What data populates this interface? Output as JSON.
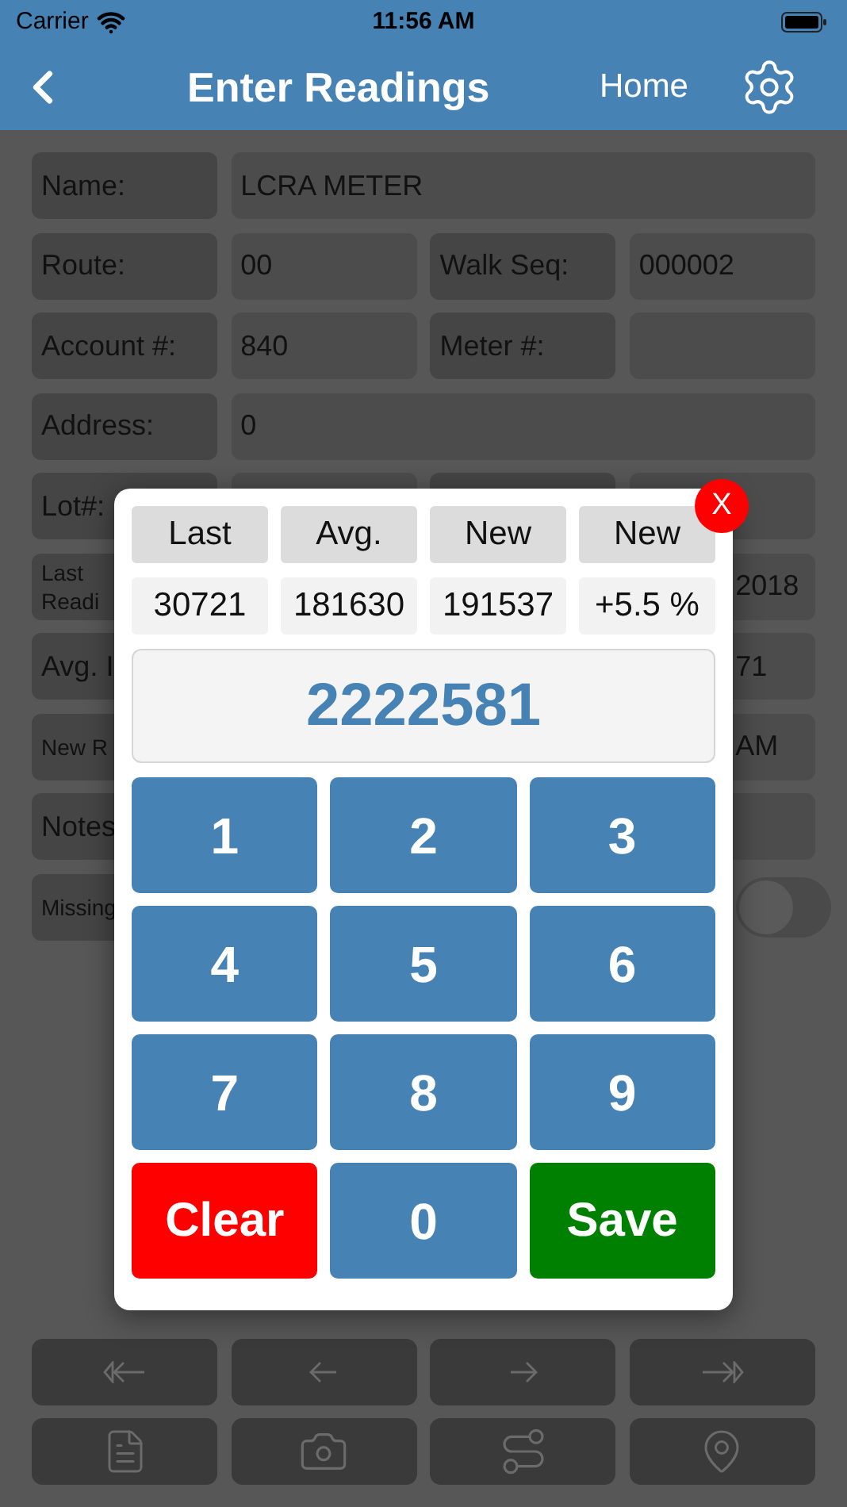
{
  "status_bar": {
    "carrier": "Carrier",
    "time": "11:56 AM"
  },
  "nav": {
    "title": "Enter Readings",
    "home": "Home"
  },
  "form": {
    "rows": [
      {
        "cells": [
          {
            "kind": "label",
            "text": "Name:"
          },
          {
            "kind": "wide",
            "text": "LCRA METER"
          }
        ]
      },
      {
        "cells": [
          {
            "kind": "label",
            "text": "Route:"
          },
          {
            "kind": "value",
            "text": "00"
          },
          {
            "kind": "label",
            "text": "Walk Seq:"
          },
          {
            "kind": "value",
            "text": "000002"
          }
        ]
      },
      {
        "cells": [
          {
            "kind": "label",
            "text": "Account #:"
          },
          {
            "kind": "value",
            "text": "840"
          },
          {
            "kind": "label",
            "text": "Meter #:"
          },
          {
            "kind": "value"
          }
        ]
      },
      {
        "cells": [
          {
            "kind": "label",
            "text": "Address:"
          },
          {
            "kind": "wide",
            "text": "0"
          }
        ]
      },
      {
        "cells": [
          {
            "kind": "label",
            "text": "Lot#:"
          },
          {
            "kind": "value"
          },
          {
            "kind": "label"
          },
          {
            "kind": "value"
          }
        ]
      },
      {
        "cells": [
          {
            "kind": "label",
            "text": "Last Readi",
            "small": true
          },
          {
            "kind": "wide",
            "text": "2018",
            "obscured": true
          }
        ]
      },
      {
        "cells": [
          {
            "kind": "label",
            "text": "Avg. I"
          },
          {
            "kind": "wide",
            "text": "71",
            "obscured": true
          }
        ]
      },
      {
        "cells": [
          {
            "kind": "label",
            "text": "New R",
            "small": true
          },
          {
            "kind": "wide",
            "text": "AM",
            "obscured": true
          }
        ]
      },
      {
        "cells": [
          {
            "kind": "label",
            "text": "Notes"
          },
          {
            "kind": "wide"
          }
        ]
      },
      {
        "cells": [
          {
            "kind": "label",
            "text": "Missing",
            "small": true
          },
          {
            "kind": "toggle",
            "on": false
          }
        ]
      }
    ]
  },
  "popup": {
    "close": "X",
    "headers": [
      "Last",
      "Avg.",
      "New",
      "New"
    ],
    "values": [
      "30721",
      "181630",
      "191537",
      "+5.5 %"
    ],
    "display": "2222581",
    "keys": [
      {
        "kind": "digit",
        "label": "1"
      },
      {
        "kind": "digit",
        "label": "2"
      },
      {
        "kind": "digit",
        "label": "3"
      },
      {
        "kind": "digit",
        "label": "4"
      },
      {
        "kind": "digit",
        "label": "5"
      },
      {
        "kind": "digit",
        "label": "6"
      },
      {
        "kind": "digit",
        "label": "7"
      },
      {
        "kind": "digit",
        "label": "8"
      },
      {
        "kind": "digit",
        "label": "9"
      },
      {
        "kind": "clear",
        "label": "Clear"
      },
      {
        "kind": "digit",
        "label": "0"
      },
      {
        "kind": "save",
        "label": "Save"
      }
    ]
  }
}
